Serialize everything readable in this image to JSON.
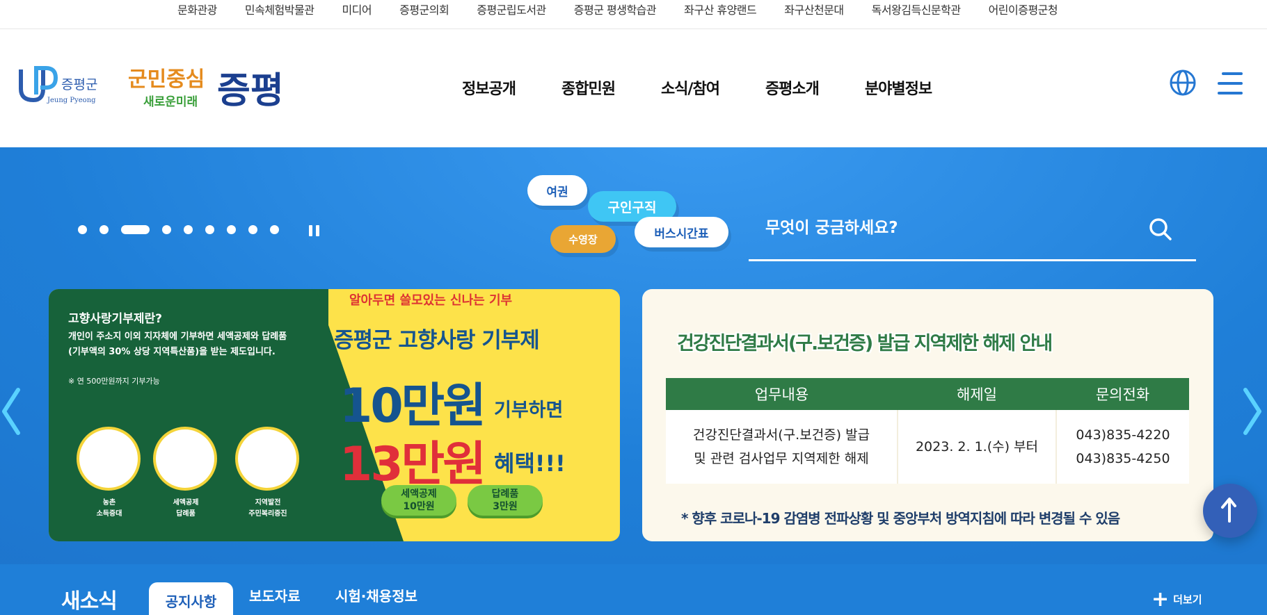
{
  "top_links": [
    "문화관광",
    "민속체험박물관",
    "미디어",
    "증평군의회",
    "증평군립도서관",
    "증평군 평생학습관",
    "좌구산 휴양랜드",
    "좌구산천문대",
    "독서왕김득신문학관",
    "어린이증평군청"
  ],
  "header": {
    "logo_name": "증평군",
    "logo_sub": "Jeung Pyeong",
    "slogan_a": "군민중심",
    "slogan_b": "새로운미래",
    "slogan_brand": "증평",
    "nav": [
      "정보공개",
      "종합민원",
      "소식/참여",
      "증평소개",
      "분야별정보"
    ]
  },
  "hero": {
    "keywords": [
      "여권",
      "구인구직",
      "수영장",
      "버스시간표"
    ],
    "search_placeholder": "무엇이 궁금하세요?",
    "slider_dots": 9,
    "active_dot": 3
  },
  "banner1": {
    "top_line": "알아두면 쓸모있는 신나는 기부",
    "title": "고향사랑기부제란?",
    "desc": "개인이 주소지 이외 지자체에 기부하면 세액공제와 답례품(기부액의 30% 상당 지역특산품)을 받는 제도입니다.",
    "note": "※ 연 500만원까지 기부가능",
    "circles": [
      "농촌\n소득증대",
      "세액공제\n답례품",
      "지역발전\n주민복리증진"
    ],
    "headline": "증평군 고향사랑 기부제",
    "amount1": "10만원",
    "amount1_suffix": "기부하면",
    "amount2": "13만원",
    "amount2_suffix": "혜택!!!",
    "pill1": "세액공제\n10만원",
    "pill2": "답례품\n3만원"
  },
  "banner2": {
    "headline": "건강진단결과서(구.보건증) 발급 지역제한 해제 안내",
    "columns": [
      "업무내용",
      "해제일",
      "문의전화"
    ],
    "row": [
      "건강진단결과서(구.보건증) 발급\n및 관련 검사업무 지역제한 해제",
      "2023. 2. 1.(수) 부터",
      "043)835-4220\n043)835-4250"
    ],
    "note": "* 향후 코로나-19 감염병 전파상황 및 중앙부처 방역지침에 따라 변경될 수 있음"
  },
  "news": {
    "title": "새소식",
    "tabs": [
      "공지사항",
      "보도자료",
      "시험·채용정보"
    ],
    "more": "더보기"
  },
  "colors": {
    "hero_blue": "#1f7fd8",
    "navy": "#15548f",
    "green": "#2f7b46",
    "orange": "#e9a634",
    "cyan": "#3fc6f4"
  }
}
